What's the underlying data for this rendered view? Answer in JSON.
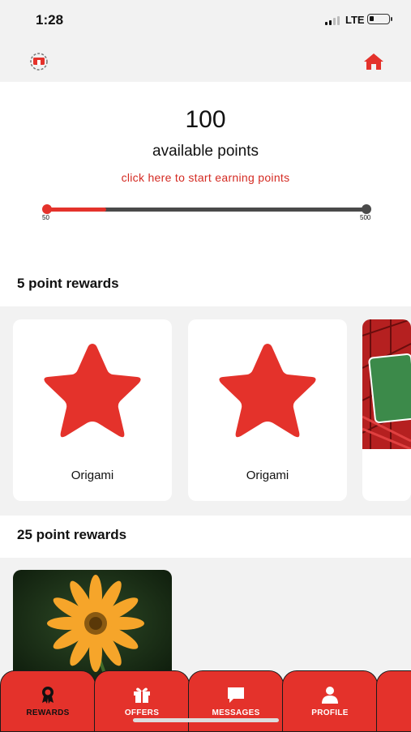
{
  "status": {
    "time": "1:28",
    "network": "LTE"
  },
  "header": {
    "logo_icon": "gift-logo-icon",
    "home_icon": "home-icon"
  },
  "points": {
    "value": "100",
    "label": "available points",
    "earn_link": "click here to start earning points",
    "progress_min": "50",
    "progress_max": "500",
    "progress_fraction": 0.19
  },
  "sections": [
    {
      "title": "5 point rewards",
      "cards": [
        {
          "label": "Origami",
          "icon": "star-icon"
        },
        {
          "label": "Origami",
          "icon": "star-icon"
        },
        {
          "label": "",
          "icon": "money-image"
        }
      ]
    },
    {
      "title": "25 point rewards",
      "cards": [
        {
          "label": "",
          "icon": "flower-image"
        }
      ]
    }
  ],
  "tabs": [
    {
      "label": "REWARDS",
      "icon": "award-icon",
      "active": true
    },
    {
      "label": "OFFERS",
      "icon": "gift-icon"
    },
    {
      "label": "MESSAGES",
      "icon": "chat-icon"
    },
    {
      "label": "PROFILE",
      "icon": "person-icon"
    }
  ],
  "colors": {
    "accent": "#e4322b",
    "track": "#4a4a4a",
    "background": "#f2f2f2"
  }
}
